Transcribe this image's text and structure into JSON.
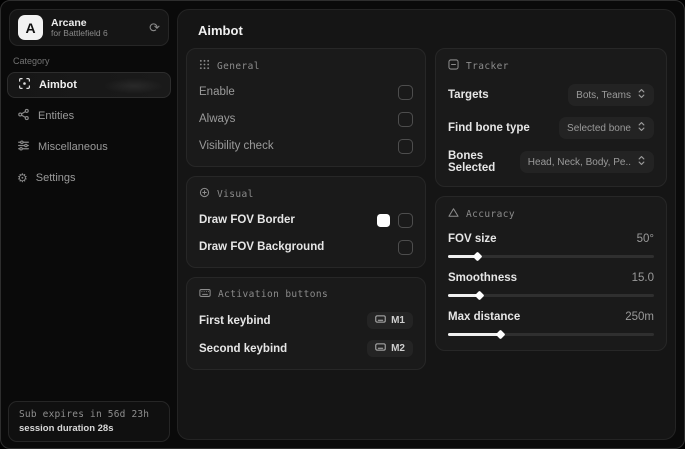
{
  "colors": {
    "window_bg": "#0a0a0a",
    "panel_bg": "#151515",
    "card_bg": "#1a1a1a",
    "accent_text": "#f0f0f0",
    "fov_border_swatch": "#ffffff"
  },
  "sidebar": {
    "brand": {
      "initial": "A",
      "name": "Arcane",
      "subtitle": "for Battlefield 6"
    },
    "category_label": "Category",
    "items": [
      {
        "label": "Aimbot",
        "icon": "crosshair-icon",
        "active": true
      },
      {
        "label": "Entities",
        "icon": "entities-icon",
        "active": false
      },
      {
        "label": "Miscellaneous",
        "icon": "sliders-icon",
        "active": false
      },
      {
        "label": "Settings",
        "icon": "gear-icon",
        "active": false
      }
    ],
    "footer": {
      "expiry": "Sub expires in 56d 23h",
      "session": "session duration 28s"
    }
  },
  "main": {
    "title": "Aimbot",
    "general": {
      "title": "General",
      "rows": [
        {
          "label": "Enable",
          "control": "checkbox",
          "checked": false
        },
        {
          "label": "Always",
          "control": "checkbox",
          "checked": false
        },
        {
          "label": "Visibility check",
          "control": "checkbox",
          "checked": false
        }
      ]
    },
    "visual": {
      "title": "Visual",
      "rows": [
        {
          "label": "Draw FOV Border",
          "control": "checkbox",
          "checked": false,
          "swatch_style": "background:#ffffff"
        },
        {
          "label": "Draw FOV Background",
          "control": "checkbox",
          "checked": false
        }
      ]
    },
    "activation": {
      "title": "Activation buttons",
      "rows": [
        {
          "label": "First keybind",
          "key": "M1"
        },
        {
          "label": "Second keybind",
          "key": "M2"
        }
      ]
    },
    "tracker": {
      "title": "Tracker",
      "rows": [
        {
          "label": "Targets",
          "value": "Bots, Teams"
        },
        {
          "label": "Find bone type",
          "value": "Selected bone"
        },
        {
          "label": "Bones Selected",
          "value": "Head, Neck, Body, Pe.."
        }
      ]
    },
    "accuracy": {
      "title": "Accuracy",
      "rows": [
        {
          "label": "FOV size",
          "value": "50°",
          "fill_style": "width:14%",
          "thumb_style": "left:14%"
        },
        {
          "label": "Smoothness",
          "value": "15.0",
          "fill_style": "width:15%",
          "thumb_style": "left:15%"
        },
        {
          "label": "Max distance",
          "value": "250m",
          "fill_style": "width:25%",
          "thumb_style": "left:25%"
        }
      ]
    }
  }
}
